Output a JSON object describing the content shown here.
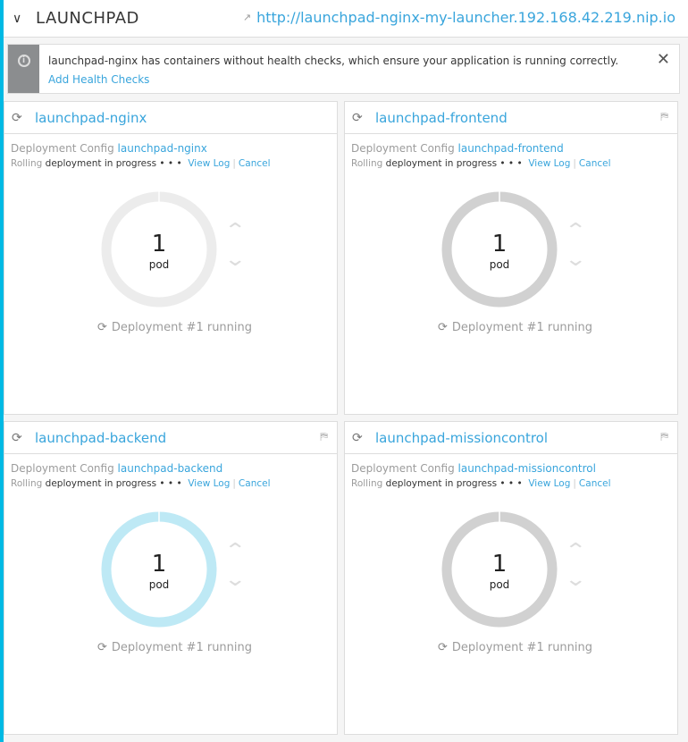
{
  "header": {
    "title": "LAUNCHPAD",
    "url": "http://launchpad-nginx-my-launcher.192.168.42.219.nip.io",
    "collapse_icon": "chevron-down-icon",
    "external_icon": "external-link-icon"
  },
  "alert": {
    "icon": "info-icon",
    "message": "launchpad-nginx has containers without health checks, which ensure your application is running correctly.",
    "link": "Add Health Checks",
    "close": "✕"
  },
  "common": {
    "config_label": "Deployment Config",
    "rolling": "Rolling",
    "in_progress": "deployment in progress",
    "dots": "• • •",
    "view_log": "View Log",
    "sep": "|",
    "cancel": "Cancel",
    "pod_label": "pod",
    "up": "⌃",
    "down": "⌄"
  },
  "cards": [
    {
      "name": "launchpad-nginx",
      "config": "launchpad-nginx",
      "pods": "1",
      "status": "Deployment #1 running",
      "ring_color": "#ececec",
      "broken_link": false
    },
    {
      "name": "launchpad-frontend",
      "config": "launchpad-frontend",
      "pods": "1",
      "status": "Deployment #1 running",
      "ring_color": "#d1d1d1",
      "broken_link": true
    },
    {
      "name": "launchpad-backend",
      "config": "launchpad-backend",
      "pods": "1",
      "status": "Deployment #1 running",
      "ring_color": "#bee9f5",
      "broken_link": true
    },
    {
      "name": "launchpad-missioncontrol",
      "config": "launchpad-missioncontrol",
      "pods": "1",
      "status": "Deployment #1 running",
      "ring_color": "#d1d1d1",
      "broken_link": true
    }
  ]
}
